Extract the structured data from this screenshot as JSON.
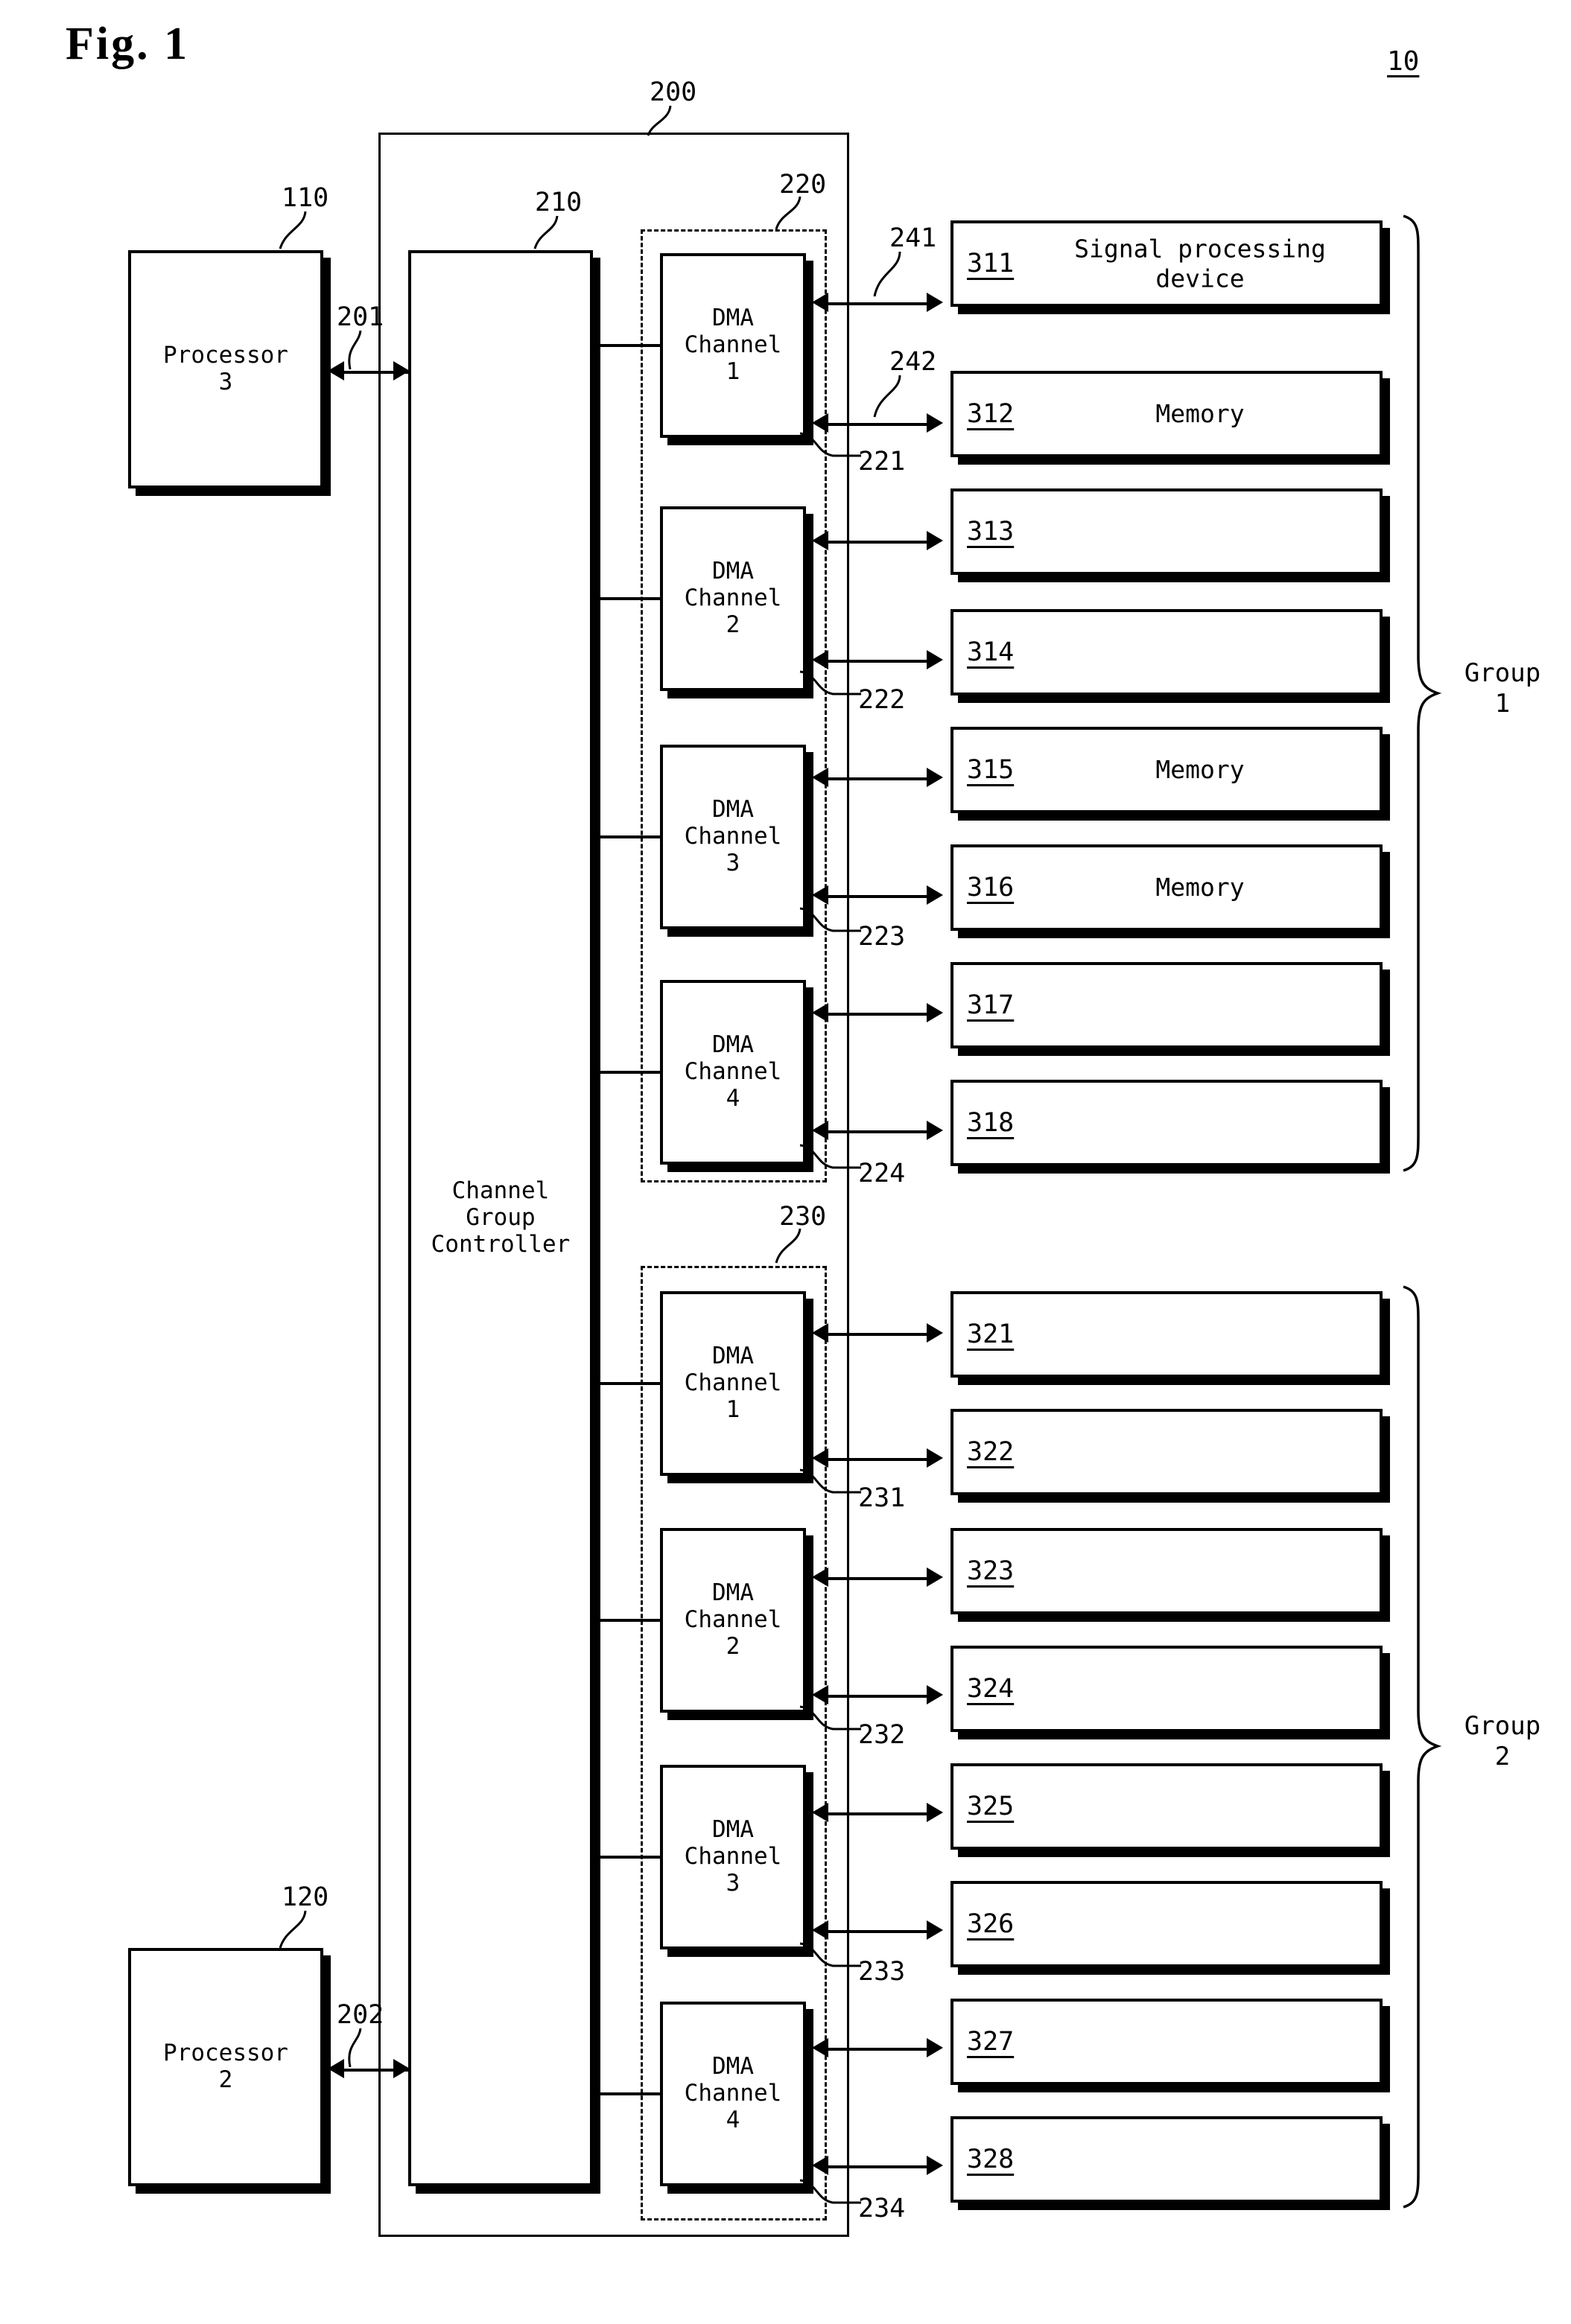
{
  "figure": {
    "title": "Fig. 1",
    "system_ref": "10"
  },
  "processors": [
    {
      "ref": "110",
      "label": "Processor\n3",
      "bus_ref": "201"
    },
    {
      "ref": "120",
      "label": "Processor\n2",
      "bus_ref": "202"
    }
  ],
  "dma_controller": {
    "ref": "200",
    "controller": {
      "ref": "210",
      "label": "Channel\nGroup\nController"
    },
    "channel_groups": [
      {
        "ref": "220",
        "channels": [
          {
            "label": "DMA\nChannel\n1",
            "ref": "221"
          },
          {
            "label": "DMA\nChannel\n2",
            "ref": "222"
          },
          {
            "label": "DMA\nChannel\n3",
            "ref": "223"
          },
          {
            "label": "DMA\nChannel\n4",
            "ref": "224"
          }
        ]
      },
      {
        "ref": "230",
        "channels": [
          {
            "label": "DMA\nChannel\n1",
            "ref": "231"
          },
          {
            "label": "DMA\nChannel\n2",
            "ref": "232"
          },
          {
            "label": "DMA\nChannel\n3",
            "ref": "233"
          },
          {
            "label": "DMA\nChannel\n4",
            "ref": "234"
          }
        ]
      }
    ]
  },
  "device_groups": [
    {
      "name": "Group\n1",
      "link_refs": [
        "241",
        "242"
      ],
      "devices": [
        {
          "ref": "311",
          "label": "Signal processing\ndevice"
        },
        {
          "ref": "312",
          "label": "Memory"
        },
        {
          "ref": "313",
          "label": ""
        },
        {
          "ref": "314",
          "label": ""
        },
        {
          "ref": "315",
          "label": "Memory"
        },
        {
          "ref": "316",
          "label": "Memory"
        },
        {
          "ref": "317",
          "label": ""
        },
        {
          "ref": "318",
          "label": ""
        }
      ]
    },
    {
      "name": "Group\n2",
      "link_refs": [],
      "devices": [
        {
          "ref": "321",
          "label": ""
        },
        {
          "ref": "322",
          "label": ""
        },
        {
          "ref": "323",
          "label": ""
        },
        {
          "ref": "324",
          "label": ""
        },
        {
          "ref": "325",
          "label": ""
        },
        {
          "ref": "326",
          "label": ""
        },
        {
          "ref": "327",
          "label": ""
        },
        {
          "ref": "328",
          "label": ""
        }
      ]
    }
  ],
  "colors": {
    "ink": "#000000",
    "paper": "#ffffff"
  }
}
